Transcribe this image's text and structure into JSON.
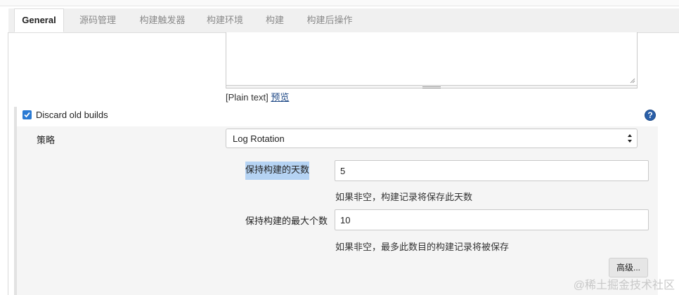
{
  "tabs": [
    {
      "label": "General",
      "active": true
    },
    {
      "label": "源码管理"
    },
    {
      "label": "构建触发器"
    },
    {
      "label": "构建环境"
    },
    {
      "label": "构建"
    },
    {
      "label": "构建后操作"
    }
  ],
  "description": {
    "plain_text": "[Plain text]",
    "preview_link": "预览"
  },
  "discard": {
    "checked": true,
    "label": "Discard old builds",
    "help": "?"
  },
  "strategy": {
    "label": "策略",
    "selected": "Log Rotation"
  },
  "days_to_keep": {
    "label": "保持构建的天数",
    "value": "5",
    "hint": "如果非空，构建记录将保存此天数"
  },
  "num_to_keep": {
    "label": "保持构建的最大个数",
    "value": "10",
    "hint": "如果非空，最多此数目的构建记录将被保存"
  },
  "advanced_button": "高级...",
  "watermark": "@稀土掘金技术社区",
  "colors": {
    "accent": "#2a7ad3",
    "highlight": "#b5d3f3",
    "help": "#2a5fa8"
  }
}
